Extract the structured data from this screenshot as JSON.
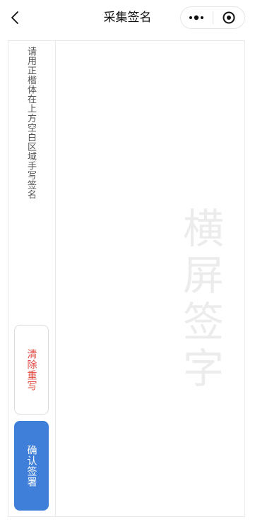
{
  "navbar": {
    "title": "采集签名",
    "back_icon": "chevron-left-icon",
    "more_icon": "more-dots-icon",
    "close_icon": "target-close-icon"
  },
  "side_panel": {
    "hint": "请用正楷体在上方空白区域手写签名",
    "clear_label": "清除重写",
    "confirm_label": "确认签署"
  },
  "canvas": {
    "watermark": "横屏签字"
  },
  "colors": {
    "accent": "#3f7fd9",
    "danger_text": "#e0483e",
    "border": "#e9e9e9",
    "watermark": "#ececec"
  }
}
